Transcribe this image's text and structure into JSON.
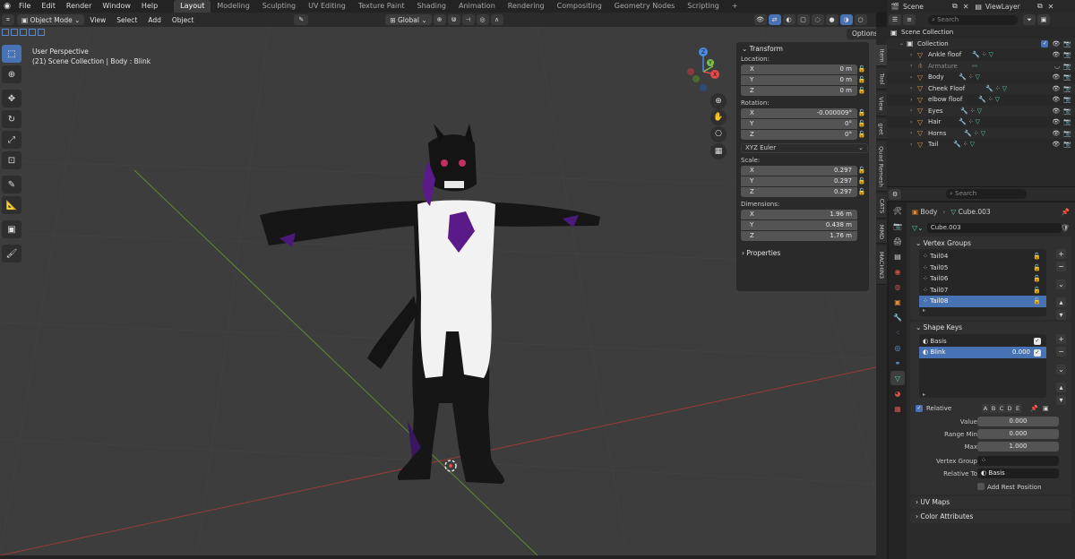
{
  "menubar": {
    "menus": [
      "File",
      "Edit",
      "Render",
      "Window",
      "Help"
    ],
    "workspaces": [
      "Layout",
      "Modeling",
      "Sculpting",
      "UV Editing",
      "Texture Paint",
      "Shading",
      "Animation",
      "Rendering",
      "Compositing",
      "Geometry Nodes",
      "Scripting"
    ],
    "active_workspace": "Layout",
    "scene": "Scene",
    "view_layer": "ViewLayer"
  },
  "viewport_header": {
    "mode": "Object Mode",
    "menus": [
      "View",
      "Select",
      "Add",
      "Object"
    ],
    "transform_orientation": "Global",
    "options": "Options"
  },
  "viewport": {
    "perspective": "User Perspective",
    "context": "(21) Scene Collection | Body : Blink",
    "axes": {
      "x": "X",
      "y": "Y",
      "z": "Z"
    }
  },
  "npanel": {
    "title": "Transform",
    "location_label": "Location:",
    "location": [
      {
        "axis": "X",
        "value": "0 m"
      },
      {
        "axis": "Y",
        "value": "0 m"
      },
      {
        "axis": "Z",
        "value": "0 m"
      }
    ],
    "rotation_label": "Rotation:",
    "rotation": [
      {
        "axis": "X",
        "value": "-0.000009°"
      },
      {
        "axis": "Y",
        "value": "0°"
      },
      {
        "axis": "Z",
        "value": "0°"
      }
    ],
    "rotation_mode": "XYZ Euler",
    "scale_label": "Scale:",
    "scale": [
      {
        "axis": "X",
        "value": "0.297"
      },
      {
        "axis": "Y",
        "value": "0.297"
      },
      {
        "axis": "Z",
        "value": "0.297"
      }
    ],
    "dimensions_label": "Dimensions:",
    "dimensions": [
      {
        "axis": "X",
        "value": "1.96 m"
      },
      {
        "axis": "Y",
        "value": "0.438 m"
      },
      {
        "axis": "Z",
        "value": "1.76 m"
      }
    ],
    "properties": "Properties"
  },
  "vertical_tabs": [
    "Item",
    "Tool",
    "View",
    "gret",
    "Quad Remesh",
    "CATS",
    "MMD",
    "MACHIN3"
  ],
  "outliner": {
    "search_placeholder": "Search",
    "root": "Scene Collection",
    "collection": "Collection",
    "items": [
      "Ankle floof",
      "Armature",
      "Body",
      "Cheek Floof",
      "elbow floof",
      "Eyes",
      "Hair",
      "Horns",
      "Tail"
    ]
  },
  "properties": {
    "search_placeholder": "Search",
    "breadcrumb_object": "Body",
    "breadcrumb_mesh": "Cube.003",
    "mesh_name": "Cube.003",
    "vertex_groups_title": "Vertex Groups",
    "vertex_groups": [
      "Tail04",
      "Tail05",
      "Tail06",
      "Tail07",
      "Tail08"
    ],
    "shape_keys_title": "Shape Keys",
    "shape_keys": [
      {
        "name": "Basis",
        "value": ""
      },
      {
        "name": "Blink",
        "value": "0.000"
      }
    ],
    "relative_label": "Relative",
    "relative_letters": [
      "A",
      "B",
      "C",
      "D",
      "E"
    ],
    "value_label": "Value",
    "value": "0.000",
    "range_min_label": "Range Min",
    "range_min": "0.000",
    "max_label": "Max",
    "max": "1.000",
    "vertex_group_label": "Vertex Group",
    "relative_to_label": "Relative To",
    "relative_to": "Basis",
    "add_rest_position": "Add Rest Position",
    "uv_maps": "UV Maps",
    "color_attributes": "Color Attributes"
  },
  "colors": {
    "accent": "#4772b3",
    "x_axis": "#e04a4a",
    "y_axis": "#7ac24b",
    "z_axis": "#4a8ae0"
  }
}
